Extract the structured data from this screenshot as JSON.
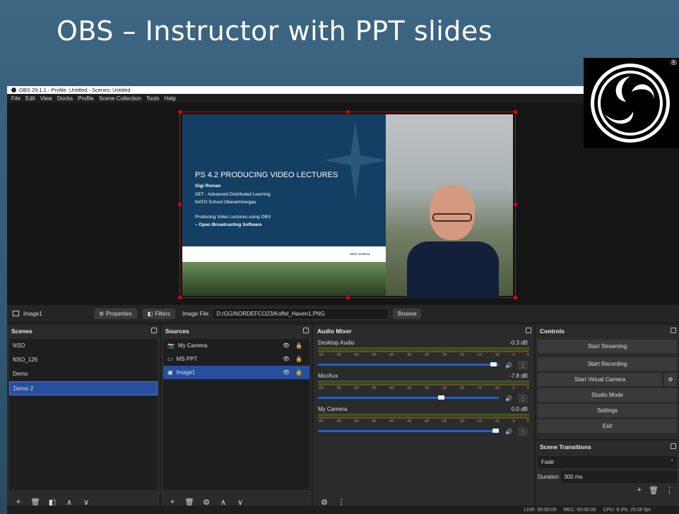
{
  "slide": {
    "title": "OBS – Instructor with PPT slides",
    "logo_mark": "®"
  },
  "obs": {
    "window_title": "OBS 29.1.1 - Profile: Untitled - Scenes: Untitled",
    "menu": [
      "File",
      "Edit",
      "View",
      "Docks",
      "Profile",
      "Scene Collection",
      "Tools",
      "Help"
    ],
    "preview_slide": {
      "title": "PS 4.2 PRODUCING VIDEO LECTURES",
      "name": "Gigi Roman",
      "line1": "SET - Advanced Distributed Learning",
      "line2": "NATO School Oberammergau",
      "line3": "Producing Video Lectures using OBS",
      "line4": "– Open Broadcasting Software",
      "badge": "NATO SCHOOL"
    },
    "propbar": {
      "source_name": "Image1",
      "properties": "Properties",
      "filters": "Filters",
      "file_label": "Image File",
      "file_path": "D:/GG/NORDEFCO23/Koffel_Haven1.PNG",
      "browse": "Browse"
    },
    "scenes": {
      "title": "Scenes",
      "items": [
        "NSO",
        "NSO_126",
        "Demo",
        "Demo 2"
      ]
    },
    "sources": {
      "title": "Sources",
      "items": [
        {
          "label": "My Camera",
          "icon": "camera-icon"
        },
        {
          "label": "MS PPT",
          "icon": "window-icon"
        },
        {
          "label": "Image1",
          "icon": "image-icon"
        }
      ]
    },
    "mixer": {
      "title": "Audio Mixer",
      "scale": [
        "-60",
        "-55",
        "-50",
        "-45",
        "-40",
        "-35",
        "-30",
        "-25",
        "-20",
        "-15",
        "-10",
        "-5",
        "0"
      ],
      "channels": [
        {
          "name": "Desktop Audio",
          "level": "-0.3 dB",
          "slider": 0.99
        },
        {
          "name": "Mic/Aux",
          "level": "-7.8 dB",
          "slider": 0.7
        },
        {
          "name": "My Camera",
          "level": "0.0 dB",
          "slider": 1.0
        }
      ]
    },
    "controls": {
      "title": "Controls",
      "buttons": [
        "Start Streaming",
        "Start Recording",
        "Start Virtual Camera",
        "Studio Mode",
        "Settings",
        "Exit"
      ]
    },
    "transitions": {
      "title": "Scene Transitions",
      "type": "Fade",
      "duration_label": "Duration",
      "duration": "300 ms"
    },
    "status": {
      "live": "LIVE: 00:00:00",
      "rec": "REC: 00:00:00",
      "cpu": "CPU: 8.3%, 25.00 fps"
    }
  }
}
